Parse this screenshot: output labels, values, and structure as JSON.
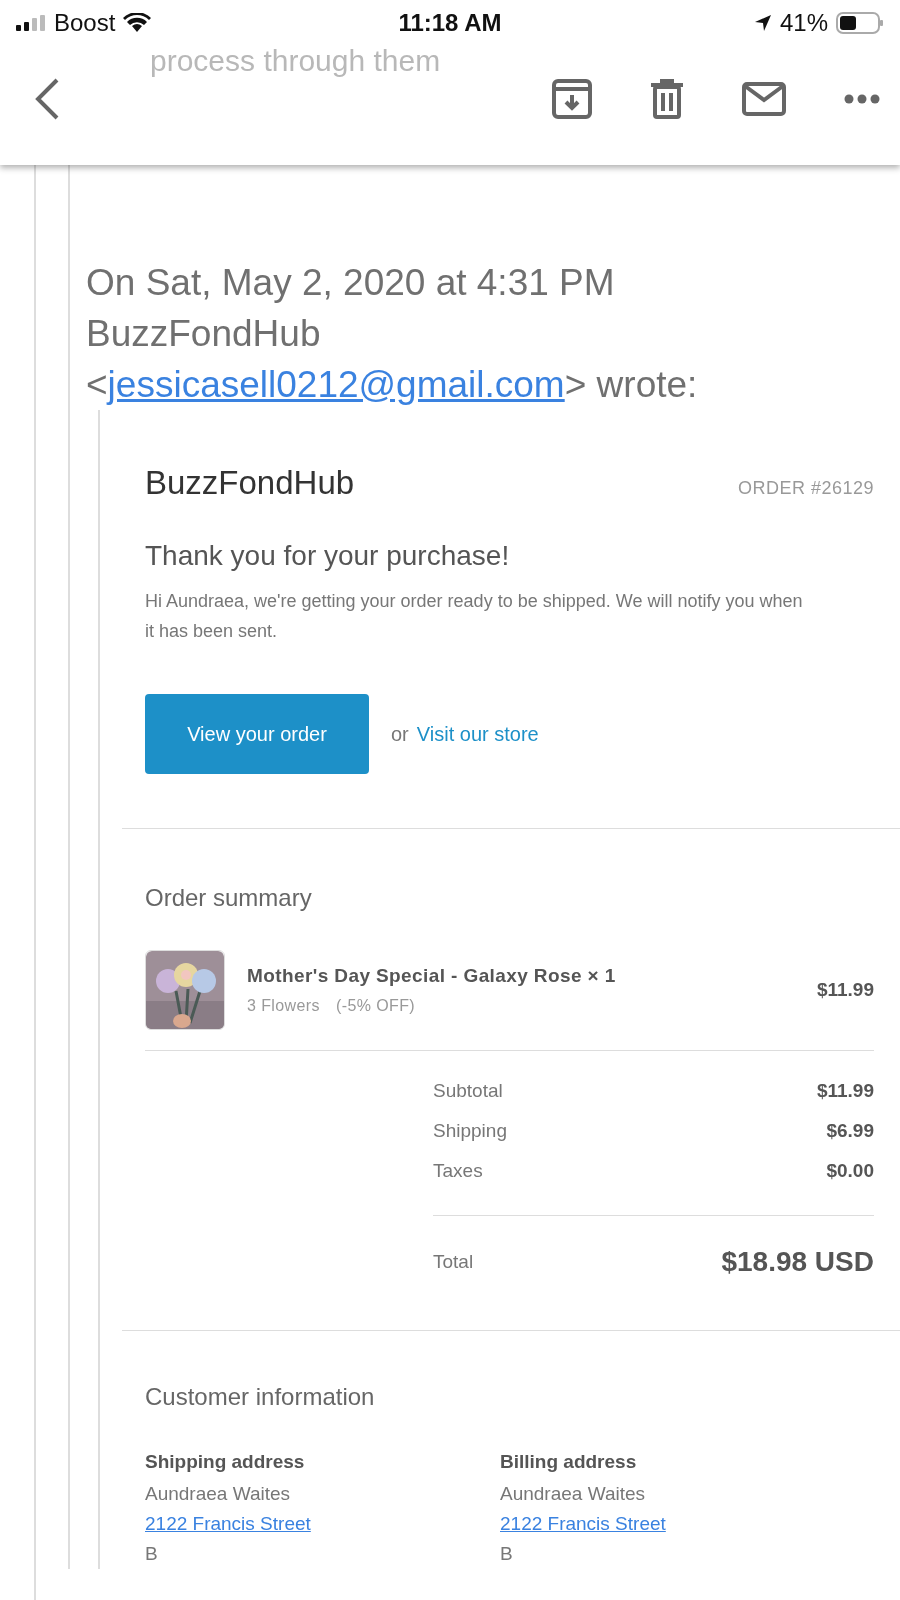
{
  "status_bar": {
    "carrier": "Boost",
    "time": "11:18 AM",
    "battery": "41%"
  },
  "behind_text": "process through them",
  "quote_header": {
    "date_line": "On Sat, May 2, 2020 at 4:31 PM",
    "sender": "BuzzFondHub",
    "email": "jessicasell0212@gmail.com",
    "wrote": "> wrote:",
    "open": "<"
  },
  "email": {
    "shop": "BuzzFondHub",
    "order_number": "ORDER #26129",
    "heading": "Thank you for your purchase!",
    "message": "Hi Aundraea, we're getting your order ready to be shipped. We will notify you when it has been sent.",
    "button": "View your order",
    "or": "or",
    "store_link": "Visit our store",
    "summary_title": "Order summary",
    "items": [
      {
        "title": "Mother's Day Special - Galaxy Rose × 1",
        "variant": "3 Flowers",
        "discount": "(-5% OFF)",
        "price": "$11.99"
      }
    ],
    "totals": [
      {
        "label": "Subtotal",
        "value": "$11.99"
      },
      {
        "label": "Shipping",
        "value": "$6.99"
      },
      {
        "label": "Taxes",
        "value": "$0.00"
      }
    ],
    "total": {
      "label": "Total",
      "value": "$18.98 USD"
    },
    "customer_title": "Customer information",
    "addresses": [
      {
        "title": "Shipping address",
        "name": "Aundraea Waites",
        "street": "2122 Francis Street",
        "line_3": "B"
      },
      {
        "title": "Billing address",
        "name": "Aundraea Waites",
        "street": "2122 Francis Street",
        "line_3": "B"
      }
    ]
  }
}
